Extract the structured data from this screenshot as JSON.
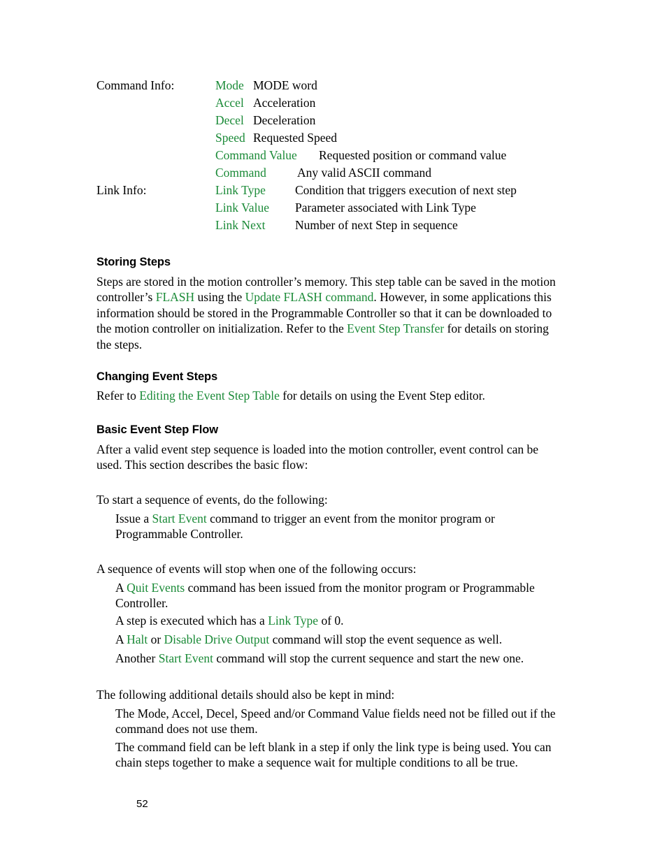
{
  "document": {
    "page_number": "52",
    "link_color": "#1a8a37",
    "text_color": "#000000",
    "background_color": "#ffffff"
  },
  "definition_block": {
    "rows": [
      {
        "group": "Command Info:",
        "term": "Mode",
        "desc": "MODE word",
        "tab": "t-narrow"
      },
      {
        "group": "",
        "term": "Accel",
        "desc": "Acceleration",
        "tab": "t-narrow"
      },
      {
        "group": "",
        "term": "Decel",
        "desc": "Deceleration",
        "tab": "t-narrow"
      },
      {
        "group": "",
        "term": "Speed",
        "desc": "Requested Speed",
        "tab": "t-narrow"
      },
      {
        "group": "",
        "term": "Command Value",
        "desc": "Requested position or command value",
        "tab": "t-mid"
      },
      {
        "group": "",
        "term": "Command",
        "desc": "Any valid ASCII command",
        "tab": "t-cmd"
      },
      {
        "group": "Link Info:",
        "term": "Link Type",
        "desc": "Condition that triggers execution of next step",
        "tab": "t-link"
      },
      {
        "group": "",
        "term": "Link Value",
        "desc": "Parameter associated with Link Type",
        "tab": "t-link"
      },
      {
        "group": "",
        "term": "Link Next",
        "desc": "Number of next Step in sequence",
        "tab": "t-link"
      }
    ]
  },
  "storing_steps": {
    "heading": "Storing Steps",
    "paragraph": {
      "p1": "Steps are stored in the motion controller’s memory.  This step table can be saved in the motion controller’s ",
      "link1": "FLASH",
      "p2": " using the ",
      "link2": "Update FLASH command",
      "p3": ".  However, in some applications this information should be stored in the Programmable Controller so that it can be downloaded to the motion controller on initialization.  Refer to the ",
      "link3": "Event Step Transfer",
      "p4": " for details on storing the steps."
    }
  },
  "changing_event_steps": {
    "heading": "Changing Event Steps",
    "paragraph": {
      "p1": "Refer to ",
      "link1": "Editing the Event Step Table",
      "p2": " for details on using the Event Step editor."
    }
  },
  "basic_event_step_flow": {
    "heading": "Basic Event Step Flow",
    "intro": "After a valid event step sequence is loaded into the motion controller, event control can be used.  This section describes the basic flow:",
    "start_lead": "To start a sequence of events, do the following:",
    "start_item": {
      "p1": "Issue a ",
      "link1": "Start Event",
      "p2": " command to trigger an event from the monitor program or Programmable Controller."
    },
    "stop_lead": "A sequence of events will stop when one of the following occurs:",
    "stop_items": {
      "item1": {
        "p1": "A ",
        "link1": "Quit Events",
        "p2": " command has been issued from the monitor program or Programmable Controller."
      },
      "item2": {
        "p1": "A step is executed which has a ",
        "link1": "Link Type",
        "p2": " of 0."
      },
      "item3": {
        "p1": "A ",
        "link1": "Halt ",
        "p2": " or ",
        "link2": "Disable Drive Output",
        "p3": " command will stop the event sequence as well."
      },
      "item4": {
        "p1": "Another ",
        "link1": "Start Event",
        "p2": " command will stop the current sequence and start the new one."
      }
    },
    "details_lead": "The following additional details should also be kept in mind:",
    "details_items": {
      "item1": "The Mode, Accel, Decel, Speed and/or Command Value fields need not be filled out if the command does not use them.",
      "item2": "The command field can be left blank in a step if only the link type is being used.  You can chain steps together to make a sequence wait for multiple conditions to all be true."
    }
  }
}
